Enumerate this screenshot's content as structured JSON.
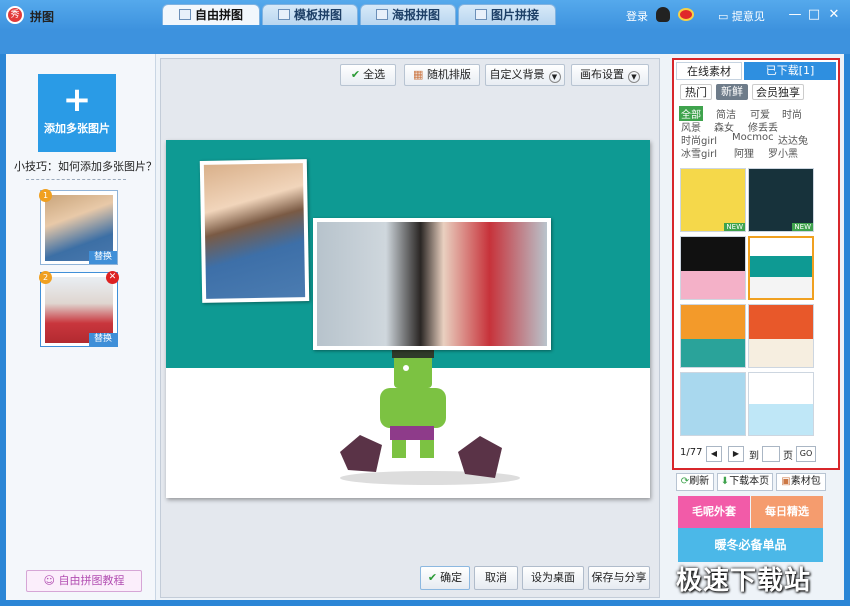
{
  "window": {
    "title": "拼图",
    "app_icon": "秀",
    "login": "登录",
    "feedback": "提意见",
    "qq_icon": "qq-icon",
    "weibo_icon": "weibo-icon"
  },
  "tabs": [
    {
      "label": "自由拼图",
      "active": true
    },
    {
      "label": "模板拼图",
      "active": false
    },
    {
      "label": "海报拼图",
      "active": false
    },
    {
      "label": "图片拼接",
      "active": false
    }
  ],
  "left_panel": {
    "add_button": "添加多张图片",
    "tip": "小技巧：如何添加多张图片？",
    "thumbnails": [
      {
        "index": "1",
        "replace": "替换"
      },
      {
        "index": "2",
        "replace": "替换"
      }
    ],
    "tutorial": "自由拼图教程"
  },
  "toolbar": {
    "select_all": "全选",
    "random_layout": "随机排版",
    "custom_bg": "自定义背景",
    "canvas_settings": "画布设置"
  },
  "bottom_buttons": {
    "confirm": "确定",
    "cancel": "取消",
    "set_desktop": "设为桌面",
    "save_share": "保存与分享"
  },
  "right_panel": {
    "tabs": [
      "在线素材",
      "已下载[1]"
    ],
    "filters": [
      "热门",
      "新鲜",
      "会员独享"
    ],
    "active_filter": "新鲜",
    "categories": [
      [
        "全部",
        "简洁",
        "可爱",
        "时尚"
      ],
      [
        "风景",
        "森女",
        "修丢丢"
      ],
      [
        "时尚girl",
        "Mocmoc",
        "达达兔"
      ],
      [
        "冰雪girl",
        "阿狸",
        "罗小黑"
      ]
    ],
    "new_tag": "NEW",
    "pagination": {
      "page": "1/77",
      "to": "到",
      "page_unit": "页",
      "go": "GO"
    },
    "actions": {
      "refresh": "刷新",
      "download_page": "下载本页",
      "material_pack": "素材包"
    },
    "banners": [
      "毛呢外套",
      "每日精选",
      "暖冬必备单品"
    ]
  },
  "watermark": "极速下载站",
  "colors": {
    "title_bar": "#3d92de",
    "accent_blue": "#2a9be6",
    "canvas_teal": "#0e9a93",
    "highlight_red": "#d8262b",
    "hulk_green": "#7cc242"
  }
}
